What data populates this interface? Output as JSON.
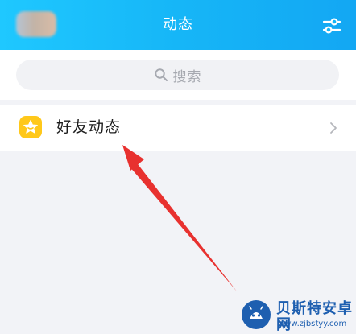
{
  "header": {
    "title": "动态",
    "avatar_icon": "avatar-blurred",
    "settings_icon": "sliders-icon"
  },
  "search": {
    "placeholder": "搜索",
    "icon": "search-icon"
  },
  "feed_items": [
    {
      "label": "好友动态",
      "icon": "star-badge-icon",
      "chevron": "chevron-right-icon"
    }
  ],
  "watermark": {
    "title": "贝斯特安卓网",
    "url": "www.zjbstyy.com"
  },
  "colors": {
    "header_start": "#1fc8ff",
    "header_end": "#13a7f3",
    "star_badge": "#ffc81a",
    "annotation_arrow": "#e8312f",
    "page_bg": "#f2f3f7"
  }
}
